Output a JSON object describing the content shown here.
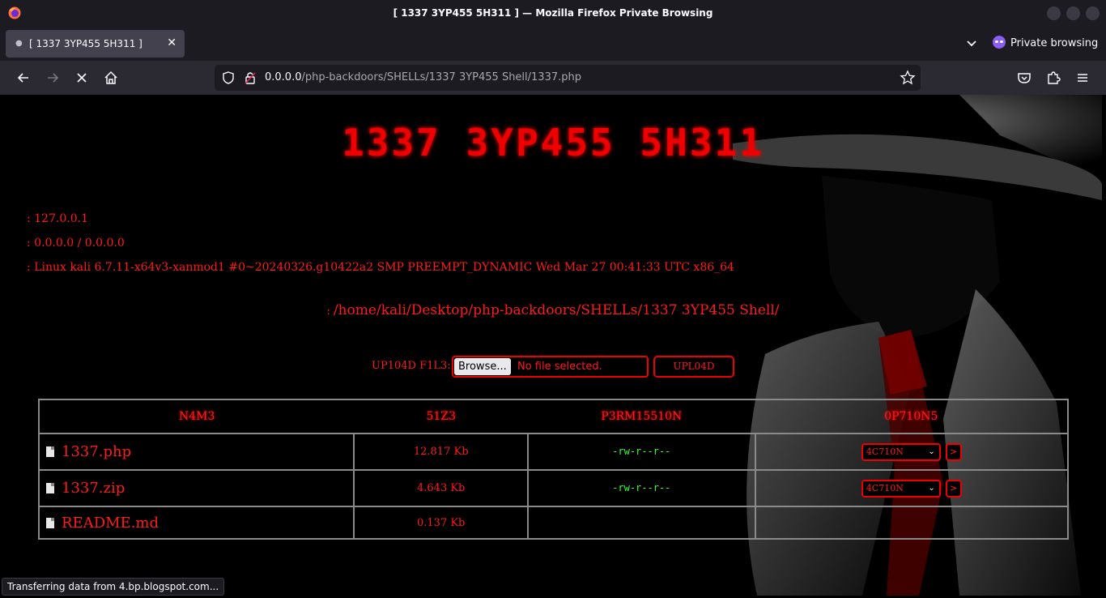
{
  "window": {
    "title": "[ 1337 3YP455 5H311 ] — Mozilla Firefox Private Browsing"
  },
  "tab": {
    "label": "[ 1337 3YP455 5H311 ]",
    "close": "✕"
  },
  "private_browsing": {
    "label": "Private browsing"
  },
  "urlbar": {
    "host": "0.0.0.0",
    "path": "/php-backdoors/SHELLs/1337 3YP455 Shell/1337.php"
  },
  "page": {
    "title": "1337 3YP455 5H311",
    "info": {
      "ip": ": 127.0.0.1",
      "server": ": 0.0.0.0 / 0.0.0.0",
      "uname": ": Linux kali 6.7.11-x64v3-xanmod1 #0~20240326.g10422a2 SMP PREEMPT_DYNAMIC Wed Mar 27 00:41:33 UTC x86_64"
    },
    "cwd_sep": ":",
    "cwd": "/home/kali/Desktop/php-backdoors/SHELLs/1337 3YP455 Shell/",
    "upload": {
      "label": "UP104D F1L3:",
      "browse": "Browse...",
      "no_file": "No file selected.",
      "button": "UPL04D"
    },
    "table": {
      "headers": [
        "N4M3",
        "51Z3",
        "P3RM15510N",
        "0P710N5"
      ],
      "rows": [
        {
          "name": "1337.php",
          "size": "12.817 Kb",
          "perm": "-rw-r--r--",
          "action": "4C710N",
          "go": ">"
        },
        {
          "name": "1337.zip",
          "size": "4.643 Kb",
          "perm": "-rw-r--r--",
          "action": "4C710N",
          "go": ">"
        },
        {
          "name": "README.md",
          "size": "0.137 Kb",
          "perm": "",
          "action": "",
          "go": ""
        }
      ]
    }
  },
  "status": "Transferring data from 4.bp.blogspot.com...",
  "colors": {
    "accent_red": "#ff0000",
    "perm_green": "#33ff33",
    "chrome_dark": "#1c1b22",
    "nav_bg": "#2b2a33"
  }
}
